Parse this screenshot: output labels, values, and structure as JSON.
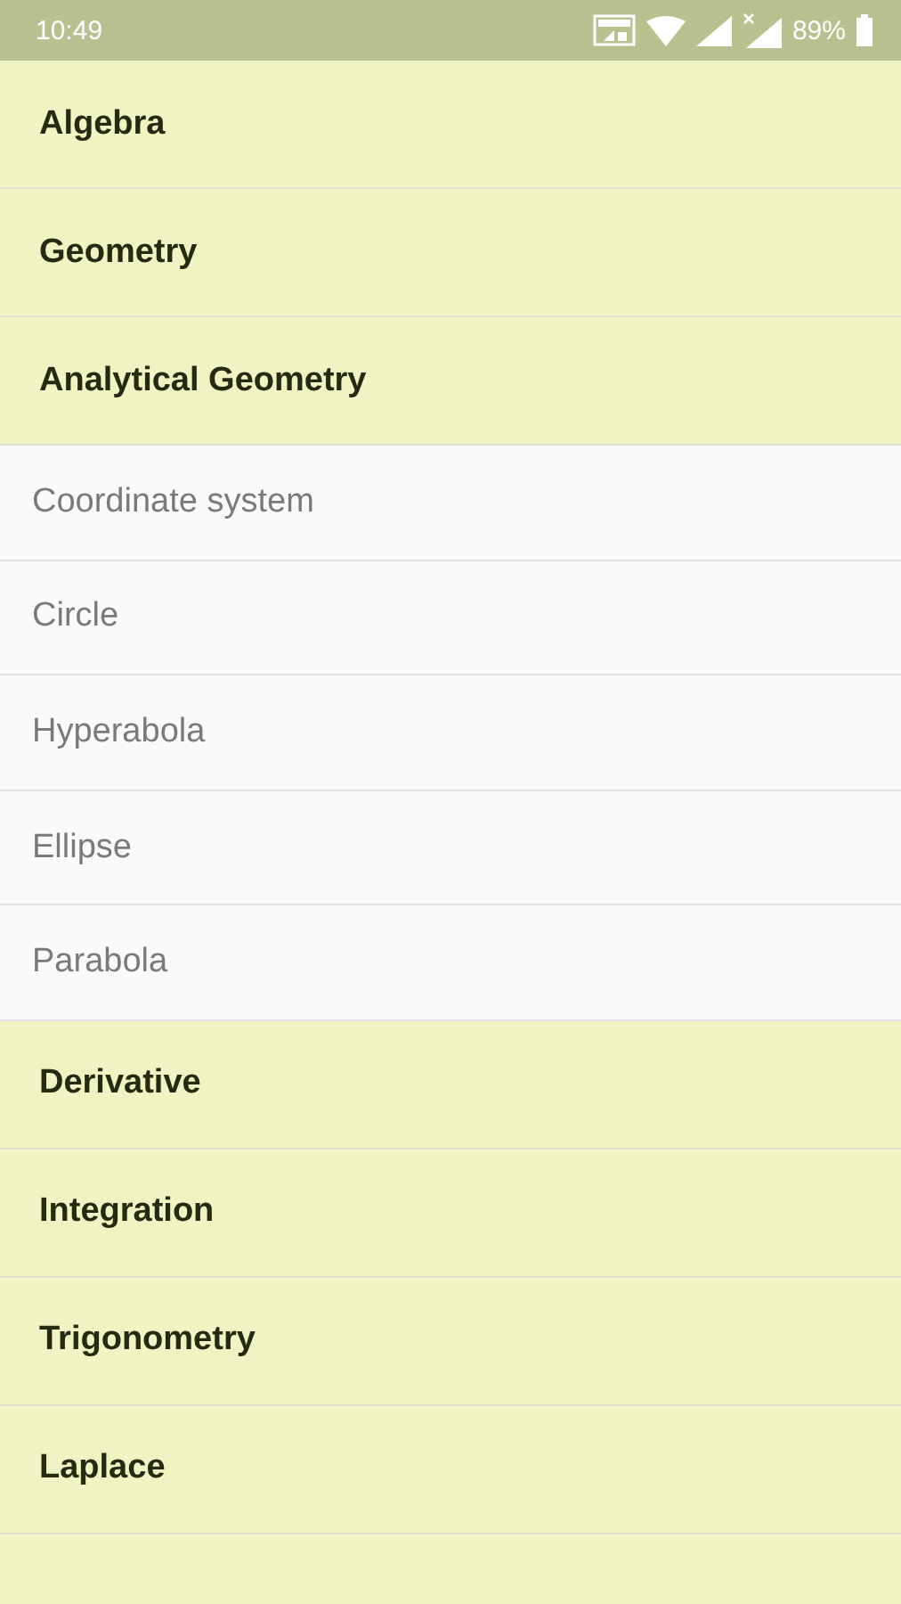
{
  "status_bar": {
    "time": "10:49",
    "battery": "89%"
  },
  "categories": [
    {
      "label": "Algebra"
    },
    {
      "label": "Geometry"
    },
    {
      "label": "Analytical Geometry",
      "children": [
        {
          "label": "Coordinate system"
        },
        {
          "label": "Circle"
        },
        {
          "label": "Hyperabola"
        },
        {
          "label": "Ellipse"
        },
        {
          "label": "Parabola"
        }
      ]
    },
    {
      "label": "Derivative"
    },
    {
      "label": "Integration"
    },
    {
      "label": "Trigonometry"
    },
    {
      "label": "Laplace"
    }
  ]
}
